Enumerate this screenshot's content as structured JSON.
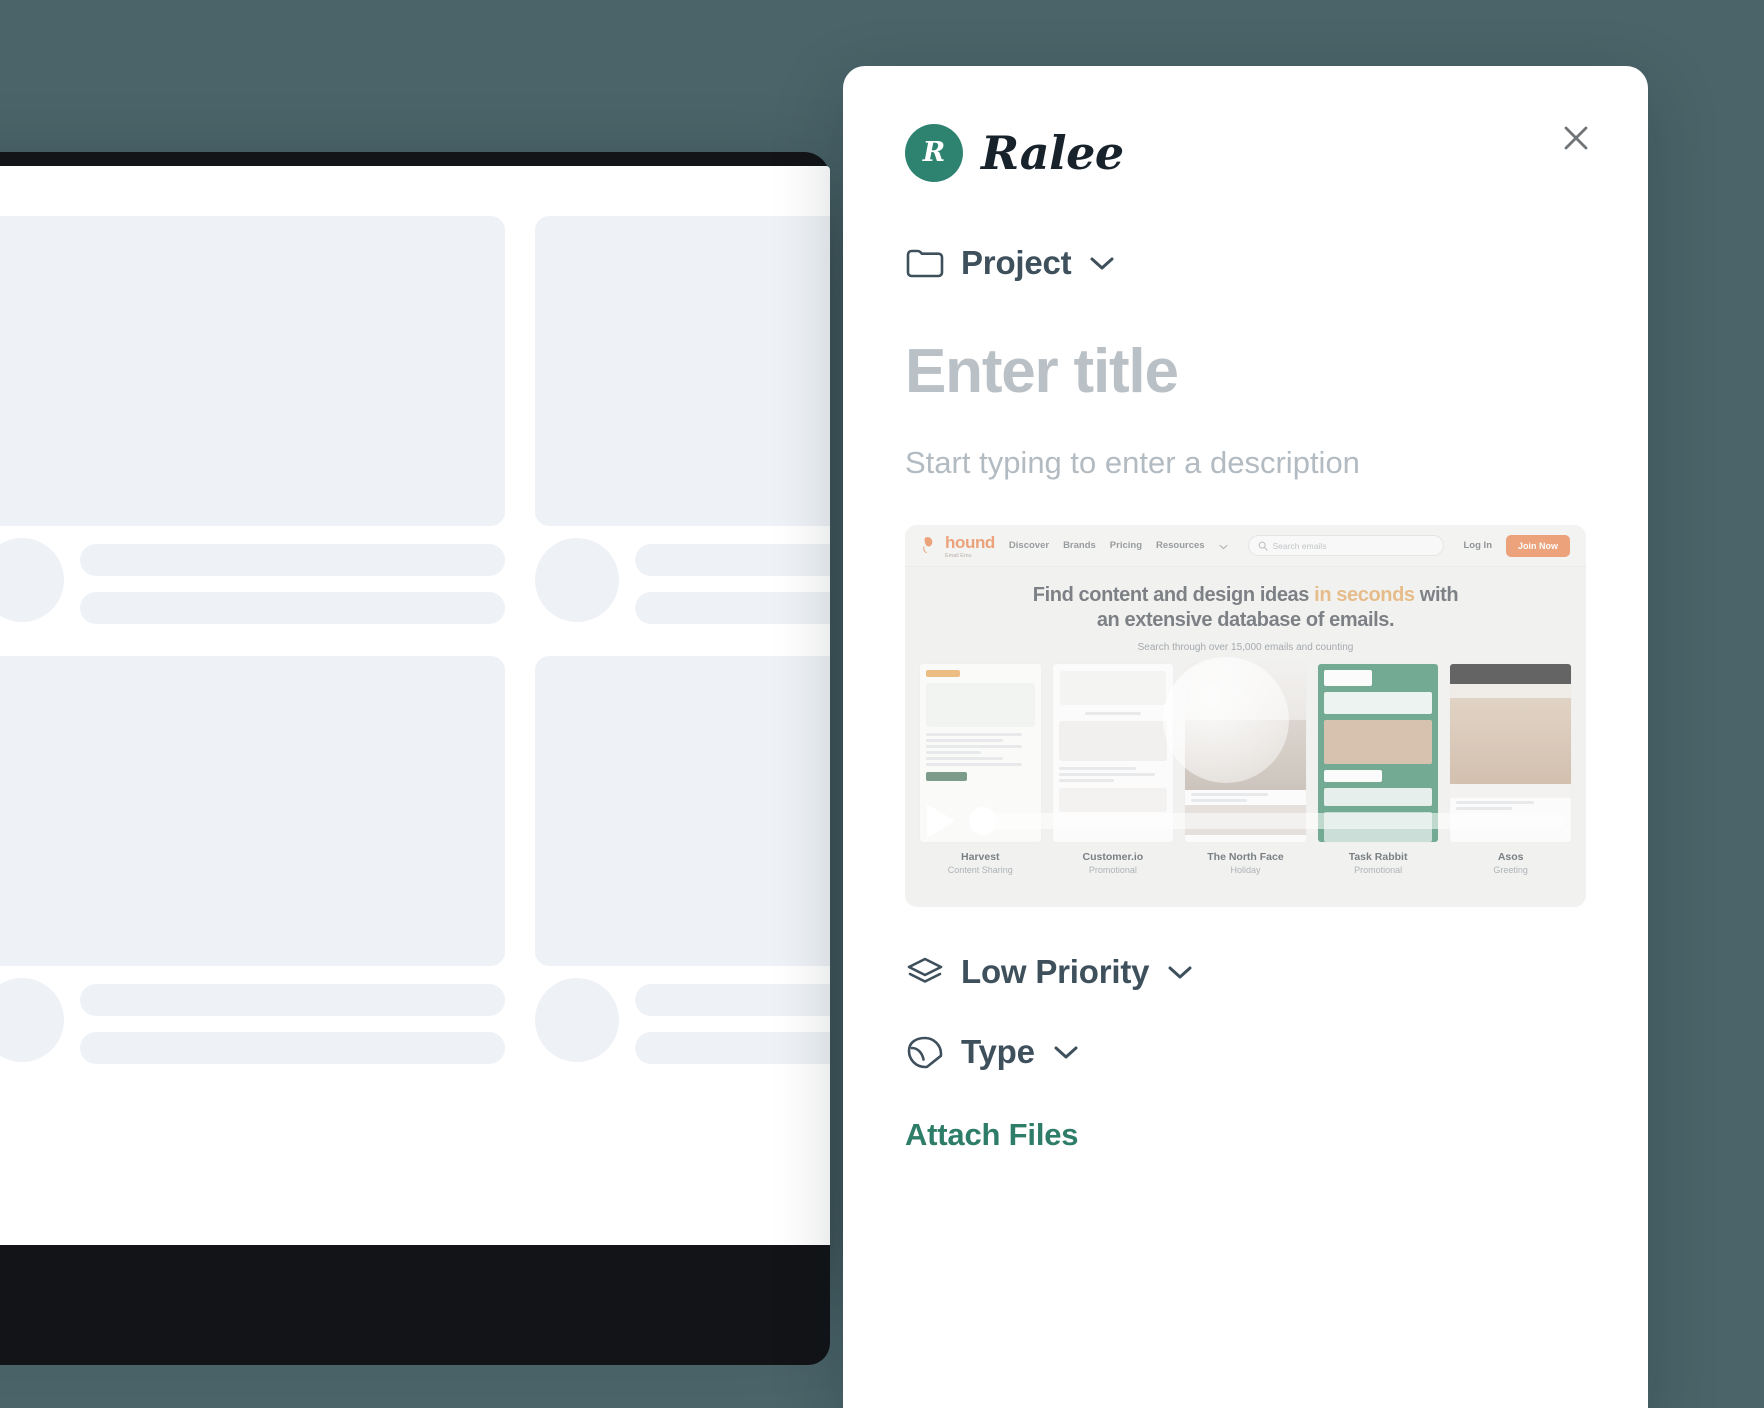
{
  "theme": {
    "backdrop": "#4a6469",
    "brand_green": "#2e8370",
    "link_green": "#2e7d68",
    "skeleton": "#eef2f6",
    "panel_bg": "#ffffff",
    "text_dark": "#3f505d",
    "placeholder_gray": "#b9c0c6"
  },
  "panel": {
    "brand": {
      "logo_letter": "R",
      "name": "Ralee"
    },
    "close_label": "Close",
    "project_selector": {
      "label": "Project",
      "icon": "folder-icon",
      "chevron": "chevron-down-icon"
    },
    "title_field": {
      "value": "",
      "placeholder": "Enter title"
    },
    "description_field": {
      "value": "",
      "placeholder": "Start typing to enter a description"
    },
    "priority_selector": {
      "label": "Low Priority",
      "icon": "layers-icon",
      "chevron": "chevron-down-icon"
    },
    "type_selector": {
      "label": "Type",
      "icon": "sticker-icon",
      "chevron": "chevron-down-icon"
    },
    "attach_files_label": "Attach Files"
  },
  "attachment_preview": {
    "kind": "video",
    "site": {
      "logo_text": "hound",
      "logo_sub": "Email Emu",
      "nav": [
        {
          "label": "Discover"
        },
        {
          "label": "Brands"
        },
        {
          "label": "Pricing"
        },
        {
          "label": "Resources"
        }
      ],
      "search_placeholder": "Search emails",
      "login_label": "Log In",
      "join_label": "Join Now",
      "headline_before": "Find content and design ideas ",
      "headline_highlight": "in seconds",
      "headline_after": " with",
      "headline_line2": "an extensive database of emails.",
      "subhead": "Search through over 15,000 emails and counting",
      "cards": [
        {
          "brand": "Harvest",
          "category": "Content Sharing"
        },
        {
          "brand": "Customer.io",
          "category": "Promotional"
        },
        {
          "brand": "The North Face",
          "category": "Holiday"
        },
        {
          "brand": "Task Rabbit",
          "category": "Promotional"
        },
        {
          "brand": "Asos",
          "category": "Greeting"
        }
      ]
    },
    "player": {
      "play_icon": "play-icon",
      "progress_percent": 0
    }
  }
}
